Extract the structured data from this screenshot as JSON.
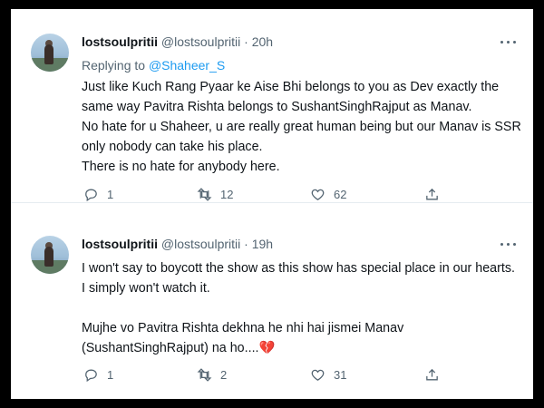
{
  "tweets": [
    {
      "display_name": "lostsoulpritii",
      "handle": "@lostsoulpritii",
      "time_sep": "·",
      "time": "20h",
      "replying_prefix": "Replying to",
      "replying_handle": "@Shaheer_S",
      "lines": [
        "Just like Kuch Rang Pyaar ke Aise Bhi  belongs to you as Dev exactly the",
        "same way Pavitra Rishta belongs to SushantSinghRajput as Manav.",
        "No hate for u Shaheer, u are really great human being but our Manav is SSR",
        "only nobody can take his place.",
        "There is no hate for anybody here."
      ],
      "reply_count": "1",
      "retweet_count": "12",
      "like_count": "62"
    },
    {
      "display_name": "lostsoulpritii",
      "handle": "@lostsoulpritii",
      "time_sep": "·",
      "time": "19h",
      "lines": [
        "I won't say to boycott the show as this show has special place in our hearts.",
        "I simply won't watch it."
      ],
      "lines2": [
        "Mujhe vo Pavitra Rishta dekhna he nhi hai jismei Manav",
        "(SushantSinghRajput) na ho...."
      ],
      "emoji": "💔",
      "reply_count": "1",
      "retweet_count": "2",
      "like_count": "31"
    }
  ],
  "icons": {
    "reply": "reply-icon",
    "retweet": "retweet-icon",
    "like": "like-icon",
    "share": "share-icon",
    "more": "more-options-icon"
  }
}
